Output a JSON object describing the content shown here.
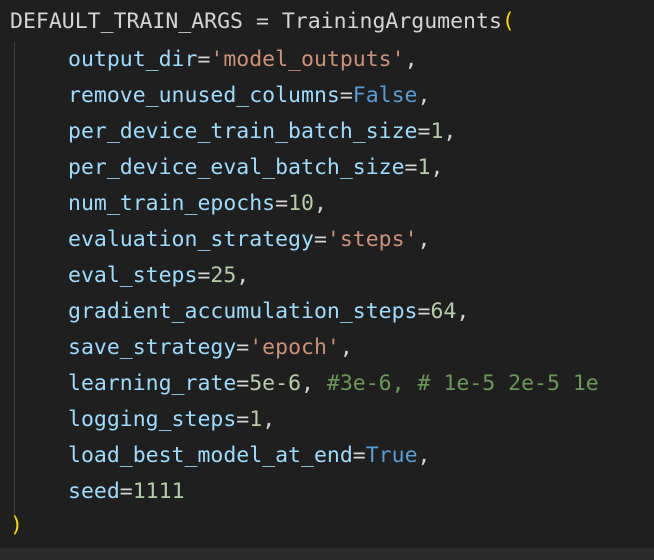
{
  "code": {
    "line1": {
      "name": "DEFAULT_TRAIN_ARGS",
      "op": " = ",
      "fn": "TrainingArguments",
      "paren": "("
    },
    "line2": {
      "param": "output_dir",
      "op": "=",
      "value": "'model_outputs'",
      "punct": ","
    },
    "line3": {
      "param": "remove_unused_columns",
      "op": "=",
      "value": "False",
      "punct": ","
    },
    "line4": {
      "param": "per_device_train_batch_size",
      "op": "=",
      "value": "1",
      "punct": ","
    },
    "line5": {
      "param": "per_device_eval_batch_size",
      "op": "=",
      "value": "1",
      "punct": ","
    },
    "line6": {
      "param": "num_train_epochs",
      "op": "=",
      "value": "10",
      "punct": ","
    },
    "line7": {
      "param": "evaluation_strategy",
      "op": "=",
      "value": "'steps'",
      "punct": ","
    },
    "line8": {
      "param": "eval_steps",
      "op": "=",
      "value": "25",
      "punct": ","
    },
    "line9": {
      "param": "gradient_accumulation_steps",
      "op": "=",
      "value": "64",
      "punct": ","
    },
    "line10": {
      "param": "save_strategy",
      "op": "=",
      "value": "'epoch'",
      "punct": ","
    },
    "line11": {
      "param": "learning_rate",
      "op": "=",
      "value": "5e-6",
      "punct": ", ",
      "comment": "#3e-6, # 1e-5 2e-5 1e"
    },
    "line12": {
      "param": "logging_steps",
      "op": "=",
      "value": "1",
      "punct": ","
    },
    "line13": {
      "param": "load_best_model_at_end",
      "op": "=",
      "value": "True",
      "punct": ","
    },
    "line14": {
      "param": "seed",
      "op": "=",
      "value": "1111"
    },
    "line15": {
      "paren": ")"
    }
  },
  "colors": {
    "background": "#1f1f1f",
    "param": "#9cdcfe",
    "string": "#ce9178",
    "keyword_constant": "#569cd6",
    "number": "#b5cea8",
    "comment": "#6a9955",
    "bracket": "#ffd700",
    "default_text": "#d4d4d4"
  }
}
